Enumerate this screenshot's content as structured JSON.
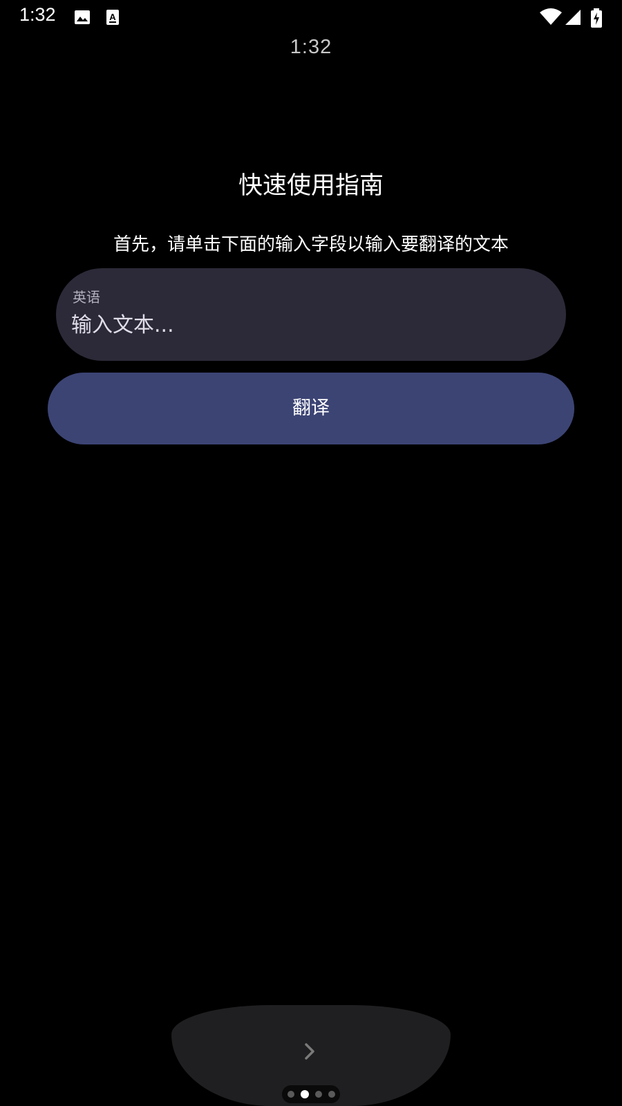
{
  "status_bar": {
    "time": "1:32",
    "icons": [
      "image-icon",
      "text-a-icon",
      "wifi-icon",
      "signal-icon",
      "battery-charging-icon"
    ]
  },
  "watch": {
    "time": "1:32"
  },
  "guide": {
    "title": "快速使用指南",
    "instruction": "首先，请单击下面的输入字段以输入要翻译的文本"
  },
  "input": {
    "language_label": "英语",
    "placeholder": "输入文本...",
    "value": ""
  },
  "translate_button": {
    "label": "翻译"
  },
  "pager": {
    "count": 4,
    "active_index": 1
  },
  "colors": {
    "background": "#000000",
    "input_bg": "#2c2a38",
    "button_bg": "#3c4474",
    "next_bg": "#1f1f21"
  }
}
